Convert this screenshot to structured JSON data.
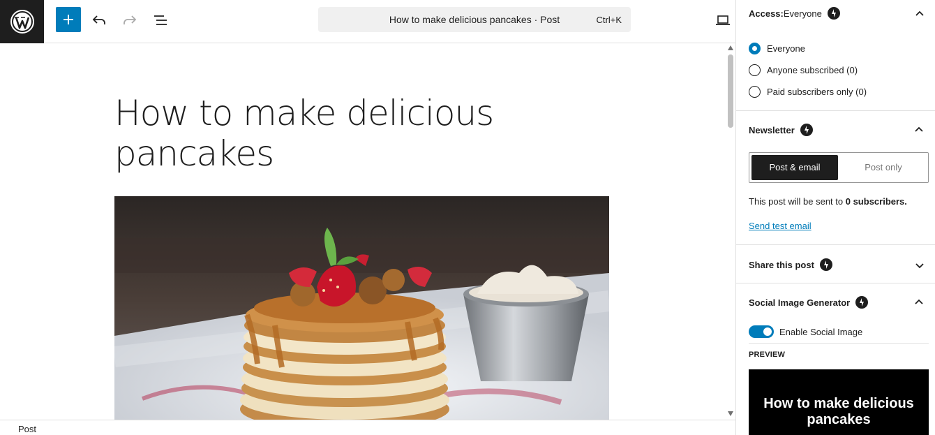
{
  "topbar": {
    "command_title": "How to make delicious pancakes · Post",
    "command_shortcut": "Ctrl+K"
  },
  "post": {
    "title": "How to make delicious pancakes"
  },
  "footer": {
    "breadcrumb": "Post"
  },
  "sidebar": {
    "access": {
      "title": "Access:",
      "value": " Everyone",
      "options": [
        "Everyone",
        "Anyone subscribed (0)",
        "Paid subscribers only (0)"
      ],
      "selected": "Everyone"
    },
    "newsletter": {
      "title": "Newsletter",
      "seg_on": "Post & email",
      "seg_off": "Post only",
      "sent_prefix": "This post will be sent to ",
      "sent_count": "0 subscribers.",
      "test_link": "Send test email"
    },
    "share": {
      "title": "Share this post"
    },
    "social": {
      "title": "Social Image Generator",
      "toggle_label": "Enable Social Image",
      "preview_label": "Preview",
      "preview_text": "How to make delicious pancakes"
    }
  },
  "colors": {
    "accent": "#007cba",
    "dark": "#1e1e1e"
  }
}
